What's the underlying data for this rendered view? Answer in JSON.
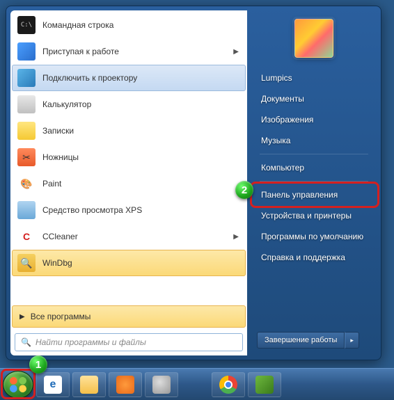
{
  "start_menu": {
    "programs": [
      {
        "label": "Командная строка",
        "icon": "cmd",
        "has_submenu": false
      },
      {
        "label": "Приступая к работе",
        "icon": "start",
        "has_submenu": true
      },
      {
        "label": "Подключить к проектору",
        "icon": "proj",
        "has_submenu": false,
        "state": "highlighted"
      },
      {
        "label": "Калькулятор",
        "icon": "calc",
        "has_submenu": false
      },
      {
        "label": "Записки",
        "icon": "notes",
        "has_submenu": false
      },
      {
        "label": "Ножницы",
        "icon": "snip",
        "has_submenu": false
      },
      {
        "label": "Paint",
        "icon": "paint",
        "has_submenu": false
      },
      {
        "label": "Средство просмотра XPS",
        "icon": "xps",
        "has_submenu": false
      },
      {
        "label": "CCleaner",
        "icon": "cc",
        "has_submenu": true
      },
      {
        "label": "WinDbg",
        "icon": "dbg",
        "has_submenu": false,
        "state": "selected"
      }
    ],
    "all_programs": "Все программы",
    "search_placeholder": "Найти программы и файлы",
    "right_items": {
      "lumpics": "Lumpics",
      "documents": "Документы",
      "pictures": "Изображения",
      "music": "Музыка",
      "computer": "Компьютер",
      "control_panel": "Панель управления",
      "devices": "Устройства и принтеры",
      "defaults": "Программы по умолчанию",
      "help": "Справка и поддержка"
    },
    "shutdown": "Завершение работы"
  },
  "annotations": {
    "badge1": "1",
    "badge2": "2"
  }
}
